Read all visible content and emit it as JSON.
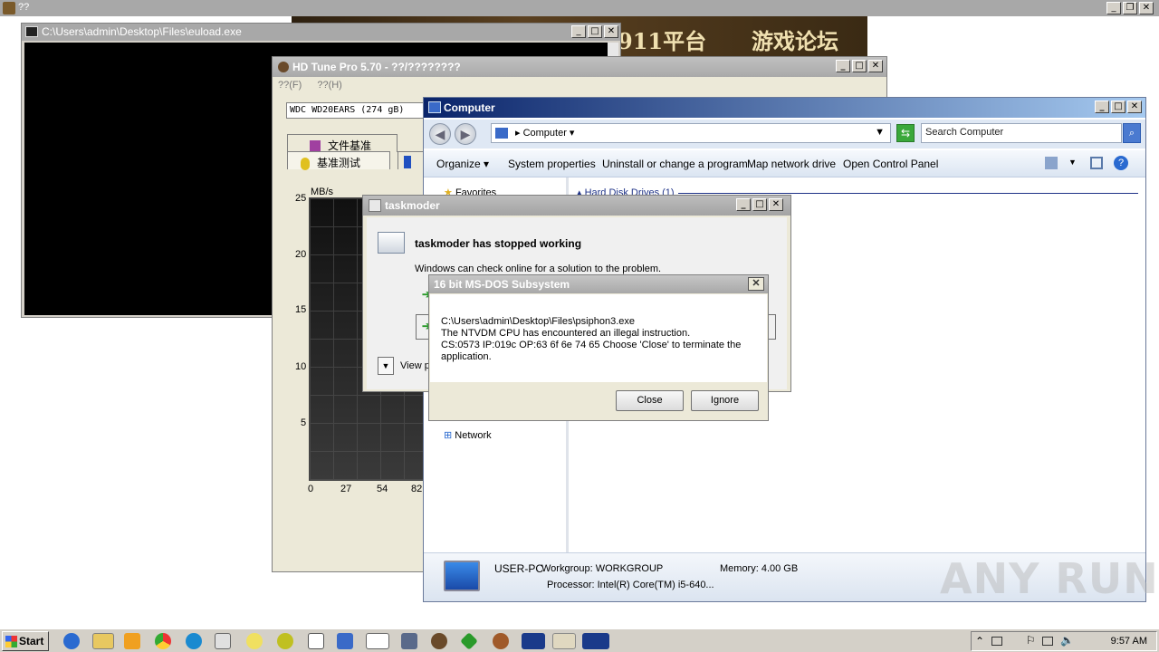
{
  "background_window": {
    "title": "??",
    "banner_text_1": "911平台",
    "banner_text_2": "游戏论坛"
  },
  "console_window": {
    "title": "C:\\Users\\admin\\Desktop\\Files\\euload.exe"
  },
  "hdtune": {
    "title": "HD Tune Pro 5.70 - ??/????????",
    "menu": [
      "??(F)",
      "??(H)"
    ],
    "drive": "WDC WD20EARS (274 gB)",
    "tabs_top": [
      "文件基准"
    ],
    "tabs_bottom": [
      "基准测试"
    ],
    "chart_unit": "MB/s",
    "y_ticks": [
      "25",
      "20",
      "15",
      "10",
      "5"
    ],
    "x_ticks": [
      "0",
      "27",
      "54",
      "82"
    ]
  },
  "computer": {
    "title": "Computer",
    "address": "Computer",
    "search_placeholder": "Search Computer",
    "commands": [
      "Organize",
      "System properties",
      "Uninstall or change a program",
      "Map network drive",
      "Open Control Panel"
    ],
    "nav_favorites": "Favorites",
    "nav_network": "Network",
    "group_header": "Hard Disk Drives (1)",
    "details": {
      "pc_name": "USER-PC",
      "workgroup": "Workgroup: WORKGROUP",
      "memory": "Memory: 4.00 GB",
      "processor": "Processor: Intel(R) Core(TM) i5-640..."
    }
  },
  "taskmoder": {
    "title": "taskmoder",
    "heading": "taskmoder has stopped working",
    "message": "Windows can check online for a solution to the problem.",
    "view_problem": "View p"
  },
  "msdos": {
    "title": "16 bit MS-DOS Subsystem",
    "line1": "C:\\Users\\admin\\Desktop\\Files\\psiphon3.exe",
    "line2": "The NTVDM CPU has encountered an illegal instruction.",
    "line3": "CS:0573 IP:019c OP:63 6f 6e 74 65 Choose 'Close' to terminate the",
    "line4": "application.",
    "close_label": "Close",
    "ignore_label": "Ignore"
  },
  "taskbar": {
    "start_label": "Start",
    "clock": "9:57 AM"
  },
  "watermark": "ANY RUN"
}
